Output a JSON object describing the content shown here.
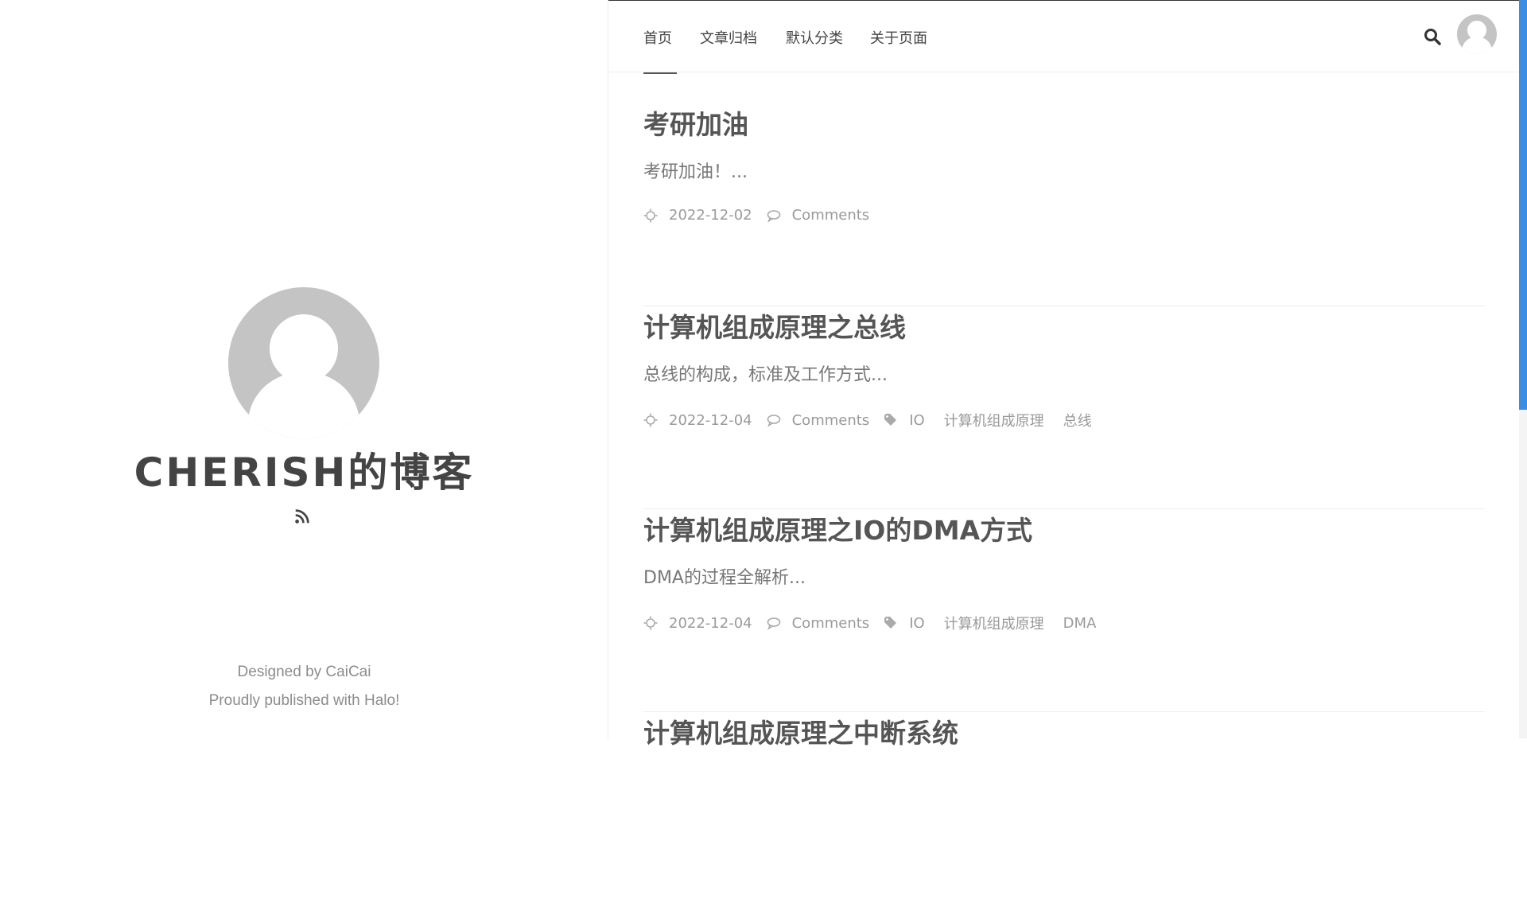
{
  "sidebar": {
    "blog_title": "CHERISH的博客",
    "footer_designed": "Designed by CaiCai",
    "footer_published": "Proudly published with Halo!"
  },
  "nav": {
    "items": [
      {
        "label": "首页"
      },
      {
        "label": "文章归档"
      },
      {
        "label": "默认分类"
      },
      {
        "label": "关于页面"
      }
    ]
  },
  "posts": [
    {
      "title": "考研加油",
      "excerpt": "考研加油！...",
      "date": "2022-12-02",
      "comments": "Comments",
      "tags": []
    },
    {
      "title": "计算机组成原理之总线",
      "excerpt": "总线的构成，标准及工作方式...",
      "date": "2022-12-04",
      "comments": "Comments",
      "tags": [
        "IO",
        "计算机组成原理",
        "总线"
      ]
    },
    {
      "title": "计算机组成原理之IO的DMA方式",
      "excerpt": "DMA的过程全解析...",
      "date": "2022-12-04",
      "comments": "Comments",
      "tags": [
        "IO",
        "计算机组成原理",
        "DMA"
      ]
    },
    {
      "title": "计算机组成原理之中断系统"
    }
  ],
  "colors": {
    "accent_scrollbar": "#3a8ee6",
    "avatar_gray": "#c4c4c4",
    "meta_gray": "#9a9a9a"
  },
  "icons": {
    "rss": "rss-icon",
    "search": "search-icon",
    "date": "sun-icon",
    "comments": "comment-bubble-icon",
    "tags": "tag-icon"
  }
}
